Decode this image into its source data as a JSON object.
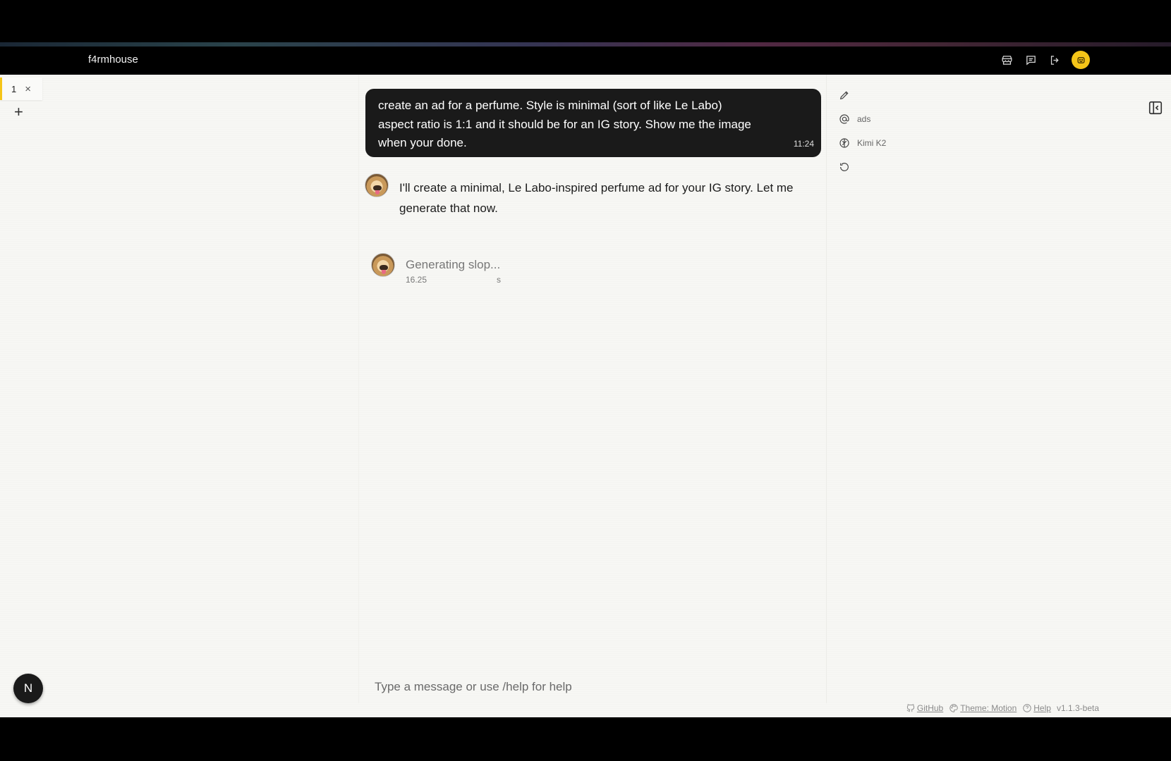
{
  "app": {
    "title": "f4rmhouse"
  },
  "topbar": {
    "icons": [
      "store-icon",
      "chat-icon",
      "logout-icon",
      "user-avatar-icon"
    ]
  },
  "tabs": [
    {
      "label": "1",
      "close": "×"
    }
  ],
  "tab_add_label": "+",
  "chat": {
    "user_message": {
      "text": "create an ad for a perfume. Style is minimal (sort of like Le Labo)\naspect ratio is 1:1 and it should be for an IG story. Show me the image\nwhen your done.",
      "time": "11:24"
    },
    "assistant_message": {
      "text": "I'll create a minimal, Le Labo-inspired perfume ad for your IG story. Let me generate that now."
    },
    "generating": {
      "label": "Generating slop...",
      "timer_value": "16.25",
      "timer_unit": "s"
    },
    "input": {
      "placeholder": "Type a message or use /help for help",
      "value": ""
    }
  },
  "tools": {
    "edit_icon": "pencil-icon",
    "mention_label": "ads",
    "model_label": "Kimi K2",
    "refresh_icon": "refresh-icon"
  },
  "fab_label": "N",
  "footer": {
    "github": "GitHub",
    "theme": "Theme: Motion",
    "help": "Help",
    "version": "v1.1.3-beta"
  },
  "colors": {
    "accent": "#f5c518",
    "bubble": "#1a1a1a",
    "background": "#f7f7f4"
  }
}
